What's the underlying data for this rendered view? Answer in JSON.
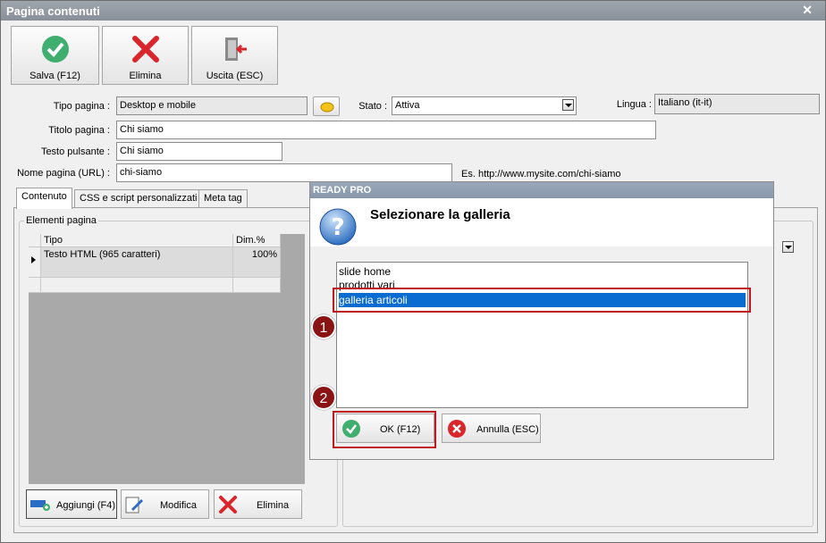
{
  "window": {
    "title": "Pagina contenuti",
    "close": "✕"
  },
  "toolbar": {
    "save_label": "Salva (F12)",
    "delete_label": "Elimina",
    "exit_label": "Uscita (ESC)"
  },
  "form": {
    "tipo_pagina_label": "Tipo pagina :",
    "tipo_pagina_value": "Desktop e mobile",
    "stato_label": "Stato :",
    "stato_value": "Attiva",
    "lingua_label": "Lingua :",
    "lingua_value": "Italiano (it-it)",
    "titolo_label": "Titolo pagina :",
    "titolo_value": "Chi siamo",
    "testo_pulsante_label": "Testo pulsante :",
    "testo_pulsante_value": "Chi siamo",
    "nome_pagina_label": "Nome pagina (URL) :",
    "nome_pagina_value": "chi-siamo",
    "url_example": "Es. http://www.mysite.com/chi-siamo"
  },
  "tabs": [
    {
      "label": "Contenuto",
      "active": true
    },
    {
      "label": "CSS e script personalizzati",
      "active": false
    },
    {
      "label": "Meta tag",
      "active": false
    }
  ],
  "elementi": {
    "group_label": "Elementi pagina",
    "columns": [
      "Tipo",
      "Dim.%"
    ],
    "rows": [
      {
        "tipo": "Testo HTML (965 caratteri)",
        "dim": "100%"
      }
    ]
  },
  "bottom_buttons": {
    "add": "Aggiungi (F4)",
    "edit": "Modifica",
    "delete": "Elimina"
  },
  "dialog": {
    "title": "READY PRO",
    "heading": "Selezionare la galleria",
    "items": [
      "slide home",
      "prodotti vari",
      "galleria articoli"
    ],
    "selected_index": 2,
    "ok_label": "OK (F12)",
    "cancel_label": "Annulla (ESC)"
  },
  "markers": [
    "1",
    "2"
  ],
  "colors": {
    "selection": "#0a6bd1",
    "highlight": "#c0181f",
    "marker": "#8a1313",
    "ok_green": "#3fae6e",
    "cancel_red": "#d9262d"
  }
}
